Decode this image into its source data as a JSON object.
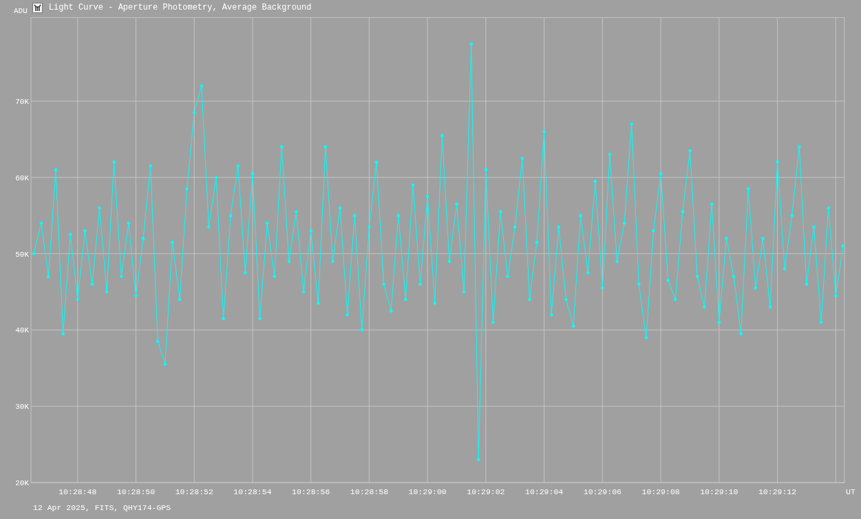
{
  "window": {
    "title": "Light Curve - Aperture Photometry, Average Background"
  },
  "chart": {
    "chart_data": {
      "type": "line",
      "ylabel": "ADU",
      "xlabel": "UT",
      "grid": true,
      "xlim": [
        37726.4,
        37754.3
      ],
      "ylim": [
        20000,
        81000
      ],
      "yticks": [
        {
          "value": 20000,
          "label": "20K"
        },
        {
          "value": 30000,
          "label": "30K"
        },
        {
          "value": 40000,
          "label": "40K"
        },
        {
          "value": 50000,
          "label": "50K"
        },
        {
          "value": 60000,
          "label": "60K"
        },
        {
          "value": 70000,
          "label": "70K"
        }
      ],
      "xticks": [
        {
          "value": 37728,
          "label": "10:28:48"
        },
        {
          "value": 37730,
          "label": "10:28:50"
        },
        {
          "value": 37732,
          "label": "10:28:52"
        },
        {
          "value": 37734,
          "label": "10:28:54"
        },
        {
          "value": 37736,
          "label": "10:28:56"
        },
        {
          "value": 37738,
          "label": "10:28:58"
        },
        {
          "value": 37740,
          "label": "10:29:00"
        },
        {
          "value": 37742,
          "label": "10:29:02"
        },
        {
          "value": 37744,
          "label": "10:29:04"
        },
        {
          "value": 37746,
          "label": "10:29:06"
        },
        {
          "value": 37748,
          "label": "10:29:08"
        },
        {
          "value": 37750,
          "label": "10:29:10"
        },
        {
          "value": 37752,
          "label": "10:29:12"
        }
      ],
      "x": [
        37726.5,
        37726.75,
        37727,
        37727.25,
        37727.5,
        37727.75,
        37728,
        37728.25,
        37728.5,
        37728.75,
        37729,
        37729.25,
        37729.5,
        37729.75,
        37730,
        37730.25,
        37730.5,
        37730.75,
        37731,
        37731.25,
        37731.5,
        37731.75,
        37732,
        37732.25,
        37732.5,
        37732.75,
        37733,
        37733.25,
        37733.5,
        37733.75,
        37734,
        37734.25,
        37734.5,
        37734.75,
        37735,
        37735.25,
        37735.5,
        37735.75,
        37736,
        37736.25,
        37736.5,
        37736.75,
        37737,
        37737.25,
        37737.5,
        37737.75,
        37738,
        37738.25,
        37738.5,
        37738.75,
        37739,
        37739.25,
        37739.5,
        37739.75,
        37740,
        37740.25,
        37740.5,
        37740.75,
        37741,
        37741.25,
        37741.5,
        37741.75,
        37742,
        37742.25,
        37742.5,
        37742.75,
        37743,
        37743.25,
        37743.5,
        37743.75,
        37744,
        37744.25,
        37744.5,
        37744.75,
        37745,
        37745.25,
        37745.5,
        37745.75,
        37746,
        37746.25,
        37746.5,
        37746.75,
        37747,
        37747.25,
        37747.5,
        37747.75,
        37748,
        37748.25,
        37748.5,
        37748.75,
        37749,
        37749.25,
        37749.5,
        37749.75,
        37750,
        37750.25,
        37750.5,
        37750.75,
        37751,
        37751.25,
        37751.5,
        37751.75,
        37752,
        37752.25,
        37752.5,
        37752.75,
        37753,
        37753.25,
        37753.5,
        37753.75,
        37754,
        37754.25
      ],
      "series": [
        {
          "color": "#00ffff",
          "values": [
            50000,
            54000,
            47000,
            61000,
            39500,
            52500,
            44000,
            53000,
            46000,
            56000,
            45000,
            62000,
            47000,
            54000,
            44500,
            52000,
            61500,
            38500,
            35500,
            51500,
            44000,
            58500,
            68500,
            72000,
            53500,
            60000,
            41500,
            55000,
            61500,
            47500,
            60500,
            41500,
            54000,
            47000,
            64000,
            49000,
            55500,
            45000,
            53000,
            43500,
            64000,
            49000,
            56000,
            42000,
            55000,
            40000,
            53500,
            62000,
            46000,
            42500,
            55000,
            44000,
            59000,
            46000,
            57500,
            43500,
            65500,
            49000,
            56500,
            45000,
            77500,
            23000,
            61000,
            41000,
            55500,
            47000,
            53500,
            62500,
            44000,
            51500,
            66000,
            42000,
            53500,
            44000,
            40500,
            55000,
            47500,
            59500,
            45500,
            63000,
            49000,
            54000,
            67000,
            46000,
            39000,
            53000,
            60500,
            46500,
            44000,
            55500,
            63500,
            47000,
            43000,
            56500,
            41000,
            52000,
            47000,
            39500,
            58500,
            45500,
            52000,
            43000,
            62000,
            48000,
            55000,
            64000,
            46000,
            53500,
            41000,
            56000,
            44500,
            51000
          ]
        }
      ]
    }
  },
  "footer": {
    "text": "12 Apr 2025, FITS, QHY174-GPS"
  }
}
